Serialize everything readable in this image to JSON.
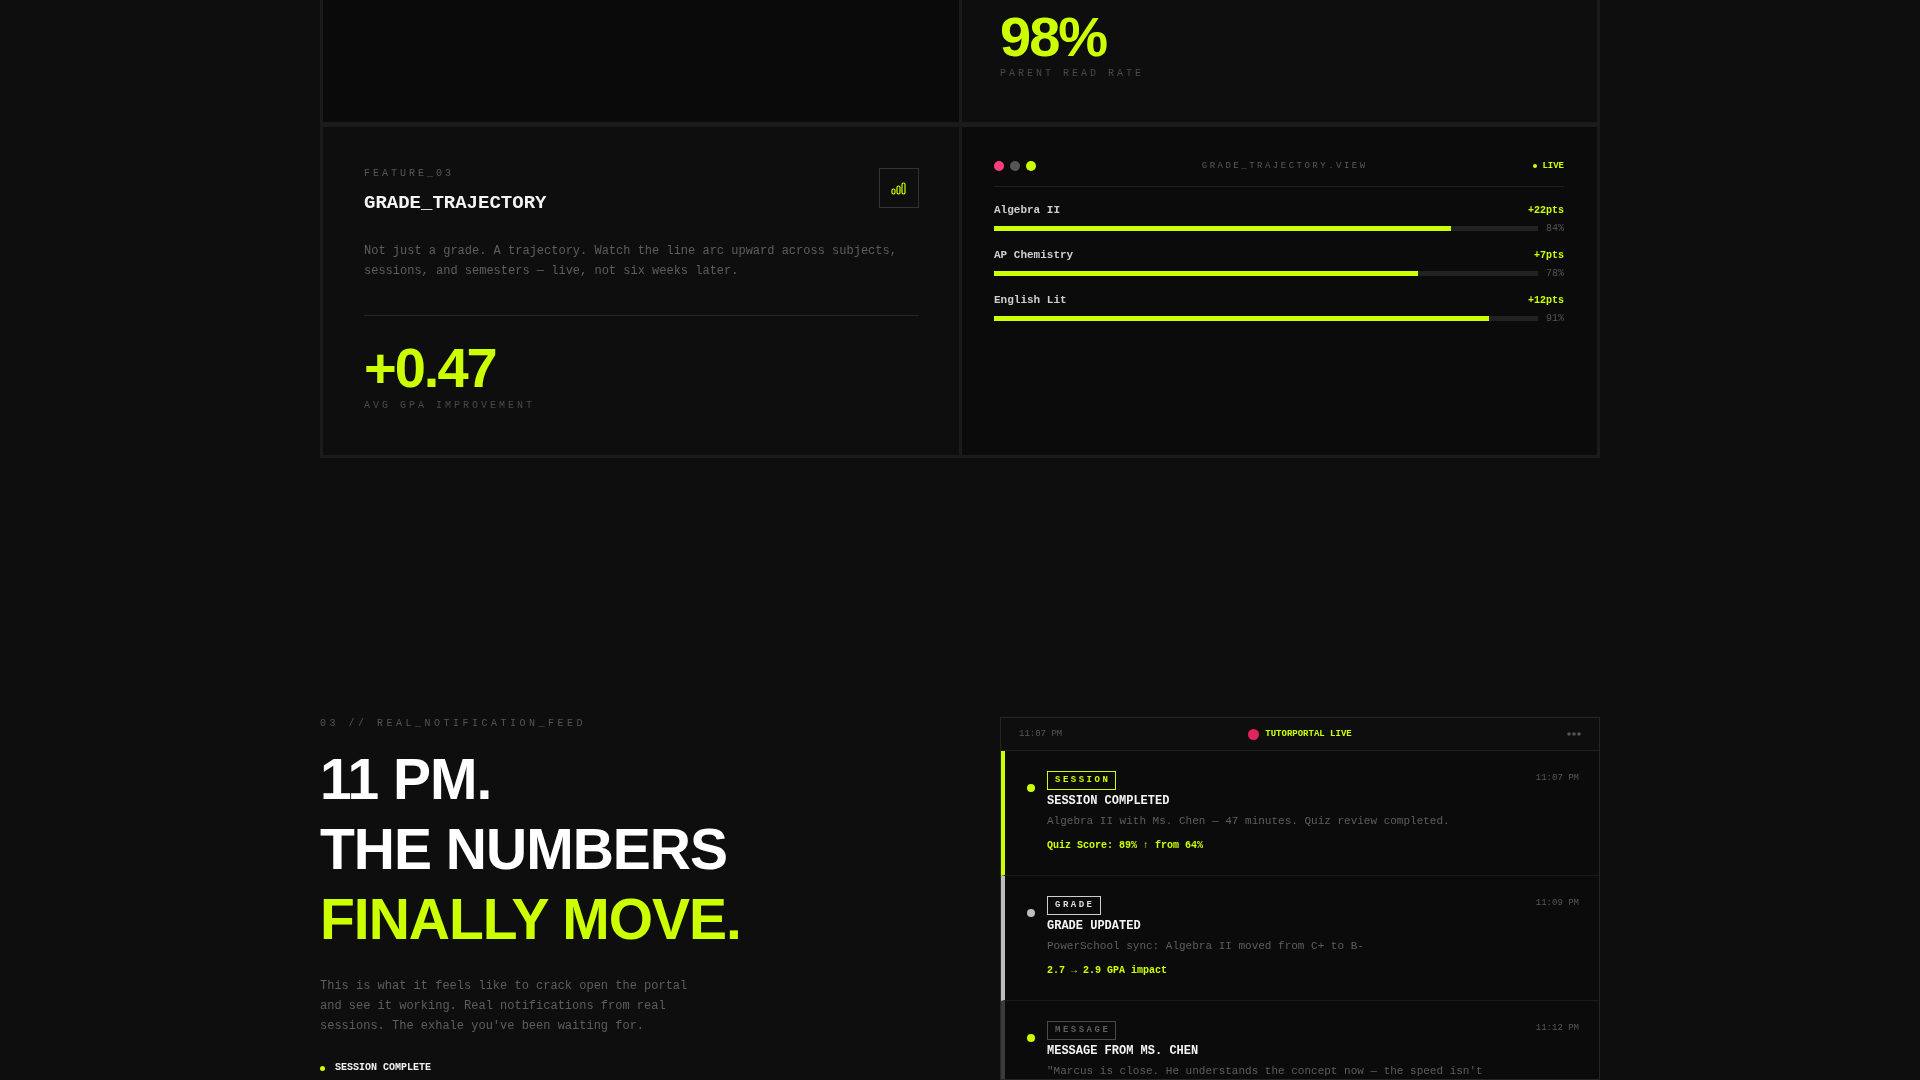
{
  "stat_card": {
    "value": "98%",
    "label": "PARENT READ RATE"
  },
  "feature": {
    "eyebrow": "FEATURE_03",
    "title": "GRADE_TRAJECTORY",
    "description": "Not just a grade. A trajectory. Watch the line arc upward across subjects, sessions, and semesters — live, not six weeks later.",
    "stat": {
      "value": "+0.47",
      "label": "AVG GPA IMPROVEMENT"
    }
  },
  "trajectory_view": {
    "title": "GRADE_TRAJECTORY.VIEW",
    "status": "LIVE",
    "subjects": [
      {
        "name": "Algebra II",
        "change": "+22pts",
        "level": 0.84,
        "percent": "84%"
      },
      {
        "name": "AP Chemistry",
        "change": "+7pts",
        "level": 0.78,
        "percent": "78%"
      },
      {
        "name": "English Lit",
        "change": "+12pts",
        "level": 0.91,
        "percent": "91%"
      }
    ]
  },
  "notification_section": {
    "eyebrow": "03 // REAL_NOTIFICATION_FEED",
    "headline": [
      {
        "text": "11 PM.",
        "highlight": false
      },
      {
        "text": "THE NUMBERS",
        "highlight": false
      },
      {
        "text": "FINALLY MOVE.",
        "highlight": true
      }
    ],
    "description": "This is what it feels like to crack open the portal and see it working. Real notifications from real sessions. The exhale you've been waiting for.",
    "checklist": [
      {
        "label": "SESSION COMPLETE"
      }
    ]
  },
  "notification_feed": {
    "clock": "11:07 PM",
    "title": "TUTORPORTAL LIVE",
    "items": [
      {
        "kind": "session",
        "color": "#ccff00",
        "tag": "SESSION",
        "time": "11:07 PM",
        "title": "SESSION COMPLETED",
        "body": "Algebra II with Ms. Chen — 47 minutes. Quiz review completed.",
        "highlight": "Quiz Score: 89% ↑ from 64%"
      },
      {
        "kind": "grade",
        "color": "#bdbdbd",
        "tag": "GRADE",
        "time": "11:09 PM",
        "title": "GRADE UPDATED",
        "body": "PowerSchool sync: Algebra II moved from C+ to B-",
        "highlight": "2.7 → 2.9 GPA impact"
      },
      {
        "kind": "message",
        "color": "#ccff00",
        "tag": "MESSAGE",
        "time": "11:12 PM",
        "title": "MESSAGE FROM MS. CHEN",
        "body": "\"Marcus is close. He understands the concept now — the speed isn't"
      }
    ]
  }
}
